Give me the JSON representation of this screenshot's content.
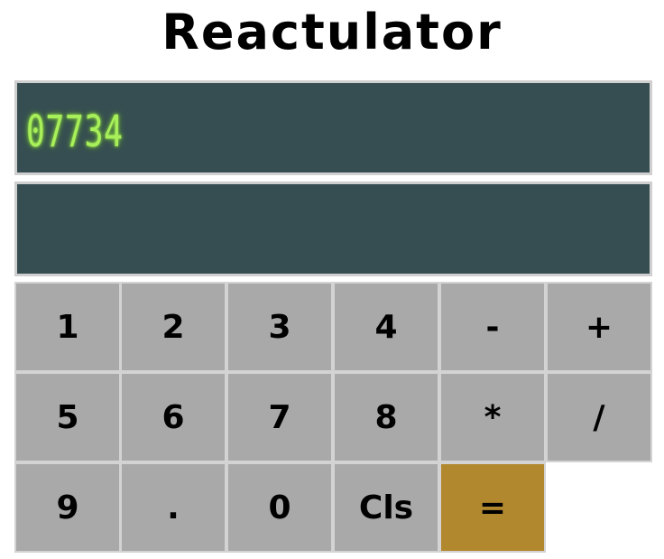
{
  "app": {
    "title": "Reactulator"
  },
  "display": {
    "primary": "07734",
    "secondary": ""
  },
  "keypad": {
    "k1": "1",
    "k2": "2",
    "k3": "3",
    "k4": "4",
    "minus": "-",
    "plus": "+",
    "k5": "5",
    "k6": "6",
    "k7": "7",
    "k8": "8",
    "multiply": "*",
    "divide": "/",
    "k9": "9",
    "decimal": ".",
    "k0": "0",
    "clear": "Cls",
    "equals": "="
  },
  "colors": {
    "display_bg": "#364e51",
    "display_text": "#a8f05a",
    "key_bg": "#a9a9a9",
    "equals_bg": "#b2882f"
  }
}
